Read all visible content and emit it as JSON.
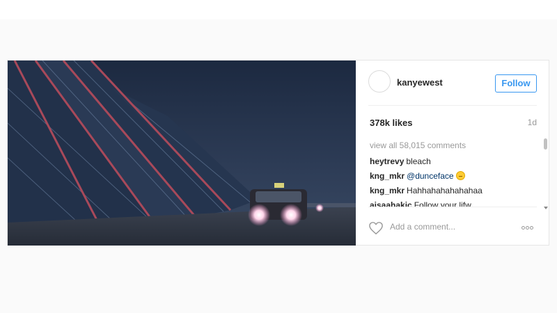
{
  "post": {
    "username": "kanyewest",
    "follow_label": "Follow",
    "likes": "378k likes",
    "age": "1d",
    "view_all": "view all 58,015 comments",
    "comments": [
      {
        "user": "heytrevy",
        "text": "bleach"
      },
      {
        "user": "kng_mkr",
        "mention": "@dunceface",
        "emoji": "expressionless-face"
      },
      {
        "user": "kng_mkr",
        "text": "Hahhahahahahahaa"
      },
      {
        "user": "aisaahakic",
        "text": "Follow your lifw"
      }
    ],
    "add_comment_placeholder": "Add a comment...",
    "icons": {
      "like": "heart-outline-icon",
      "options": "more-options-icon"
    },
    "accent_color": "#3897f0"
  }
}
